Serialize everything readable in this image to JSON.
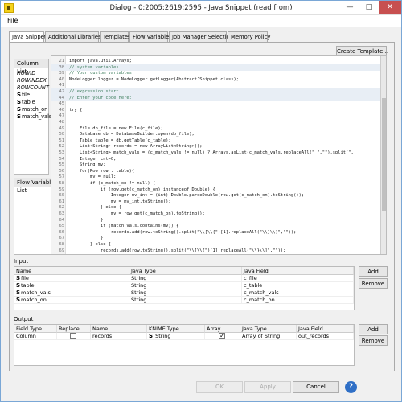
{
  "window": {
    "title": "Dialog - 0:2005:2619:2595 - Java Snippet (read from)",
    "minimize": "—",
    "maximize": "□",
    "close": "✕"
  },
  "menu": {
    "file": "File"
  },
  "tabs": [
    {
      "label": "Java Snippet",
      "active": true
    },
    {
      "label": "Additional Libraries"
    },
    {
      "label": "Templates"
    },
    {
      "label": "Flow Variables"
    },
    {
      "label": "Job Manager Selection"
    },
    {
      "label": "Memory Policy"
    }
  ],
  "toolbar": {
    "create_template": "Create Template..."
  },
  "column_list": {
    "header": "Column List",
    "items": [
      {
        "label": "ROWID",
        "italic": true,
        "dollar": false
      },
      {
        "label": "ROWINDEX",
        "italic": true,
        "dollar": false
      },
      {
        "label": "ROWCOUNT",
        "italic": true,
        "dollar": false
      },
      {
        "label": "file",
        "dollar": true
      },
      {
        "label": "table",
        "dollar": true
      },
      {
        "label": "match_on",
        "dollar": true
      },
      {
        "label": "match_vals",
        "dollar": true
      }
    ]
  },
  "flow_variable_list": {
    "header": "Flow Variable List"
  },
  "code": [
    {
      "n": "21",
      "t": "import java.util.Arrays;"
    },
    {
      "n": "38",
      "t": "// system variables",
      "comment": true,
      "guarded": true
    },
    {
      "n": "39",
      "t": "// Your custom variables:",
      "comment": true
    },
    {
      "n": "40",
      "t": "NodeLogger logger = NodeLogger.getLogger(AbstractJSnippet.class);"
    },
    {
      "n": "41",
      "t": ""
    },
    {
      "n": "42",
      "t": "// expression start",
      "comment": true,
      "guarded": true
    },
    {
      "n": "44",
      "t": "// Enter your code here:",
      "comment": true,
      "guarded": true
    },
    {
      "n": "45",
      "t": ""
    },
    {
      "n": "46",
      "t": "try {"
    },
    {
      "n": "47",
      "t": ""
    },
    {
      "n": "48",
      "t": ""
    },
    {
      "n": "49",
      "t": "    File db_file = new File(c_file);"
    },
    {
      "n": "50",
      "t": "    Database db = DatabaseBuilder.open(db_file);"
    },
    {
      "n": "51",
      "t": "    Table table = db.getTable(c_table);"
    },
    {
      "n": "52",
      "t": "    List<String> records = new ArrayList<String>();"
    },
    {
      "n": "53",
      "t": "    List<String> match_vals = (c_match_vals != null) ? Arrays.asList(c_match_vals.replaceAll(\" \",\"\").split(\","
    },
    {
      "n": "54",
      "t": "    Integer cnt=0;"
    },
    {
      "n": "55",
      "t": "    String mv;"
    },
    {
      "n": "56",
      "t": "    for(Row row : table){"
    },
    {
      "n": "57",
      "t": "        mv = null;"
    },
    {
      "n": "58",
      "t": "        if (c_match_on != null) {"
    },
    {
      "n": "59",
      "t": "            if (row.get(c_match_on) instanceof Double) {"
    },
    {
      "n": "60",
      "t": "                Integer mv_int = (int) Double.parseDouble(row.get(c_match_on).toString());"
    },
    {
      "n": "61",
      "t": "                mv = mv_int.toString();"
    },
    {
      "n": "62",
      "t": "            } else {"
    },
    {
      "n": "63",
      "t": "                mv = row.get(c_match_on).toString();"
    },
    {
      "n": "64",
      "t": "            }"
    },
    {
      "n": "65",
      "t": "            if (match_vals.contains(mv)) {"
    },
    {
      "n": "66",
      "t": "                records.add(row.toString().split(\"\\\\[\\\\{\")[1].replaceAll(\"\\\\}\\\\]\",\"\"));"
    },
    {
      "n": "67",
      "t": "            }"
    },
    {
      "n": "68",
      "t": "        } else {"
    },
    {
      "n": "69",
      "t": "            records.add(row.toString().split(\"\\\\[\\\\{\")[1].replaceAll(\"\\\\}\\\\]\",\"\"));"
    }
  ],
  "input": {
    "label": "Input",
    "headers": [
      "Name",
      "Java Type",
      "Java Field"
    ],
    "rows": [
      [
        "file",
        "String",
        "c_file"
      ],
      [
        "table",
        "String",
        "c_table"
      ],
      [
        "match_vals",
        "String",
        "c_match_vals"
      ],
      [
        "match_on",
        "String",
        "c_match_on"
      ]
    ],
    "add": "Add",
    "remove": "Remove"
  },
  "output": {
    "label": "Output",
    "headers": [
      "Field Type",
      "Replace",
      "Name",
      "KNIME Type",
      "Array",
      "Java Type",
      "Java Field"
    ],
    "rows": [
      {
        "field_type": "Column",
        "replace": false,
        "name": "records",
        "knime_type": "String",
        "array": true,
        "java_type": "Array of String",
        "java_field": "out_records"
      }
    ],
    "add": "Add",
    "remove": "Remove"
  },
  "footer": {
    "ok": "OK",
    "apply": "Apply",
    "cancel": "Cancel",
    "help": "?"
  }
}
